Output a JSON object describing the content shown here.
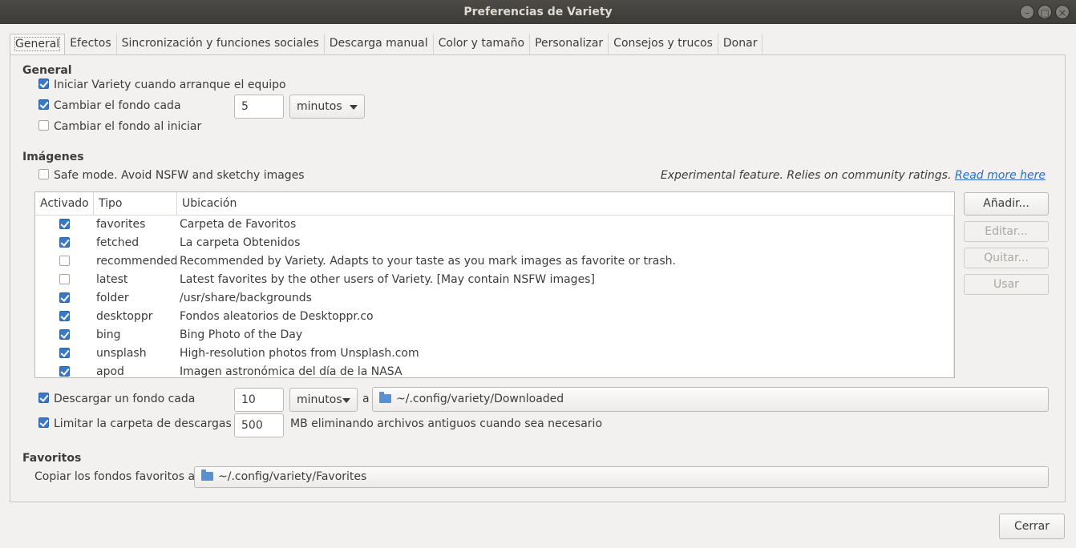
{
  "window": {
    "title": "Preferencias de Variety"
  },
  "tabs": [
    {
      "label": "General"
    },
    {
      "label": "Efectos"
    },
    {
      "label": "Sincronización y funciones sociales"
    },
    {
      "label": "Descarga manual"
    },
    {
      "label": "Color y tamaño"
    },
    {
      "label": "Personalizar"
    },
    {
      "label": "Consejos y trucos"
    },
    {
      "label": "Donar"
    }
  ],
  "general": {
    "heading": "General",
    "start_on_boot": {
      "label": "Iniciar Variety cuando arranque el equipo",
      "checked": true
    },
    "change_every": {
      "label": "Cambiar el fondo cada",
      "checked": true,
      "value": "5",
      "unit": "minutos"
    },
    "change_on_start": {
      "label": "Cambiar el fondo al iniciar",
      "checked": false
    }
  },
  "images": {
    "heading": "Imágenes",
    "safe_mode": {
      "label": "Safe mode. Avoid NSFW and sketchy images",
      "checked": false
    },
    "experimental_note": "Experimental feature. Relies on community ratings.",
    "read_more": "Read more here",
    "columns": [
      "Activado",
      "Tipo",
      "Ubicación"
    ],
    "sources": [
      {
        "enabled": true,
        "type": "favorites",
        "location": "Carpeta de Favoritos"
      },
      {
        "enabled": true,
        "type": "fetched",
        "location": "La carpeta Obtenidos"
      },
      {
        "enabled": false,
        "type": "recommended",
        "location": "Recommended by Variety. Adapts to your taste as you mark images as favorite or trash."
      },
      {
        "enabled": false,
        "type": "latest",
        "location": "Latest favorites by the other users of Variety. [May contain NSFW images]"
      },
      {
        "enabled": true,
        "type": "folder",
        "location": "/usr/share/backgrounds"
      },
      {
        "enabled": true,
        "type": "desktoppr",
        "location": "Fondos aleatorios de Desktoppr.co"
      },
      {
        "enabled": true,
        "type": "bing",
        "location": "Bing Photo of the Day"
      },
      {
        "enabled": true,
        "type": "unsplash",
        "location": "High-resolution photos from Unsplash.com"
      },
      {
        "enabled": true,
        "type": "apod",
        "location": "Imagen astronómica del día de la NASA"
      }
    ],
    "buttons": {
      "add": "Añadir...",
      "edit": "Editar...",
      "remove": "Quitar...",
      "use": "Usar"
    }
  },
  "download": {
    "every": {
      "label": "Descargar un fondo cada",
      "checked": true,
      "value": "10",
      "unit": "minutos",
      "to": "a",
      "folder": "~/.config/variety/Downloaded"
    },
    "limit": {
      "label": "Limitar la carpeta de descargas a",
      "checked": true,
      "value": "500",
      "suffix": "MB eliminando archivos antiguos cuando sea necesario"
    }
  },
  "favorites": {
    "heading": "Favoritos",
    "copy_label": "Copiar los fondos favoritos a",
    "folder": "~/.config/variety/Favorites"
  },
  "footer": {
    "close": "Cerrar"
  },
  "colors": {
    "accent": "#3a78c4",
    "titlebar": "#3c3b37",
    "link": "#2a6fc0"
  }
}
